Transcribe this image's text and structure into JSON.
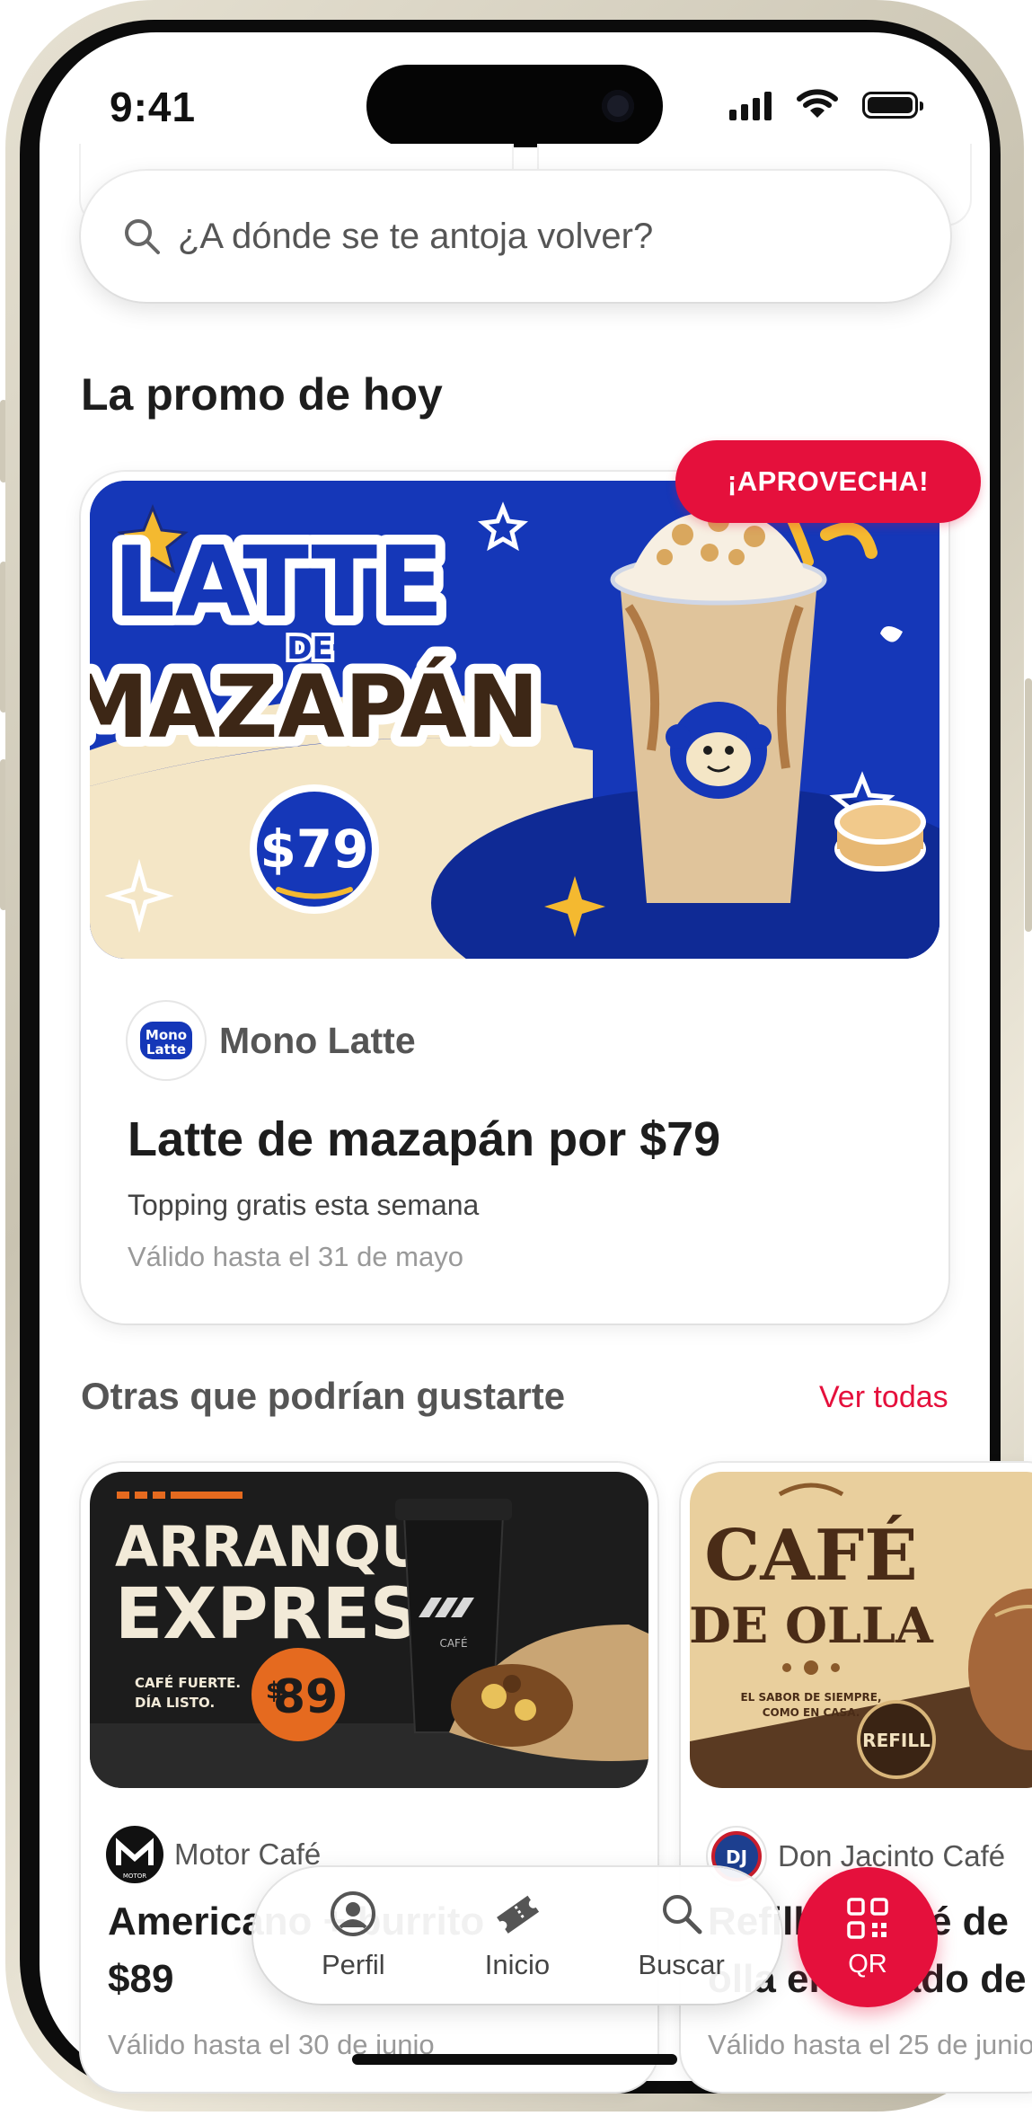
{
  "status_bar": {
    "time": "9:41"
  },
  "search": {
    "placeholder": "¿A dónde se te antoja volver?"
  },
  "promo_section": {
    "heading": "La promo de hoy",
    "badge": "¡APROVECHA!",
    "banner": {
      "line1": "LATTE",
      "line2": "DE",
      "line3": "MAZAPÁN",
      "price": "$79"
    },
    "brand_logo_text": [
      "Mono",
      "Latte"
    ],
    "brand": "Mono Latte",
    "title": "Latte de mazapán por $79",
    "subtitle": "Topping gratis esta semana",
    "valid": "Válido hasta el 31 de mayo"
  },
  "others_section": {
    "heading": "Otras que podrían gustarte",
    "see_all": "Ver todas",
    "cards": [
      {
        "banner": {
          "line1": "ARRANQUE",
          "line2": "EXPRESS",
          "tag1": "CAFÉ FUERTE.",
          "tag2": "DÍA LISTO.",
          "price_sign": "$",
          "price": "89",
          "cup": "CAFÉ"
        },
        "brand_logo_text": "MOTOR",
        "brand": "Motor Café",
        "title1": "Americano + burrito",
        "title2": "$89",
        "valid": "Válido hasta el 30 de junio"
      },
      {
        "banner": {
          "line1": "CAFÉ",
          "line2": "DE OLLA",
          "tag1": "EL SABOR DE SIEMPRE,",
          "tag2": "COMO EN CASA.",
          "refill": "REFILL"
        },
        "brand_logo_text": "DJ",
        "brand": "Don Jacinto Café",
        "title1": "Refill de café de",
        "title2": "olla ensayado de seleccion",
        "valid": "Válido hasta el 25 de junio"
      }
    ]
  },
  "tabbar": {
    "items": [
      {
        "label": "Perfil",
        "icon": "person-circle-icon"
      },
      {
        "label": "Inicio",
        "icon": "ticket-icon"
      },
      {
        "label": "Buscar",
        "icon": "search-icon"
      }
    ],
    "qr": {
      "label": "QR",
      "icon": "qr-code-icon"
    }
  },
  "colors": {
    "accent": "#e5103c",
    "banner_blue": "#1537b8",
    "banner_cream": "#f4e6c6"
  }
}
